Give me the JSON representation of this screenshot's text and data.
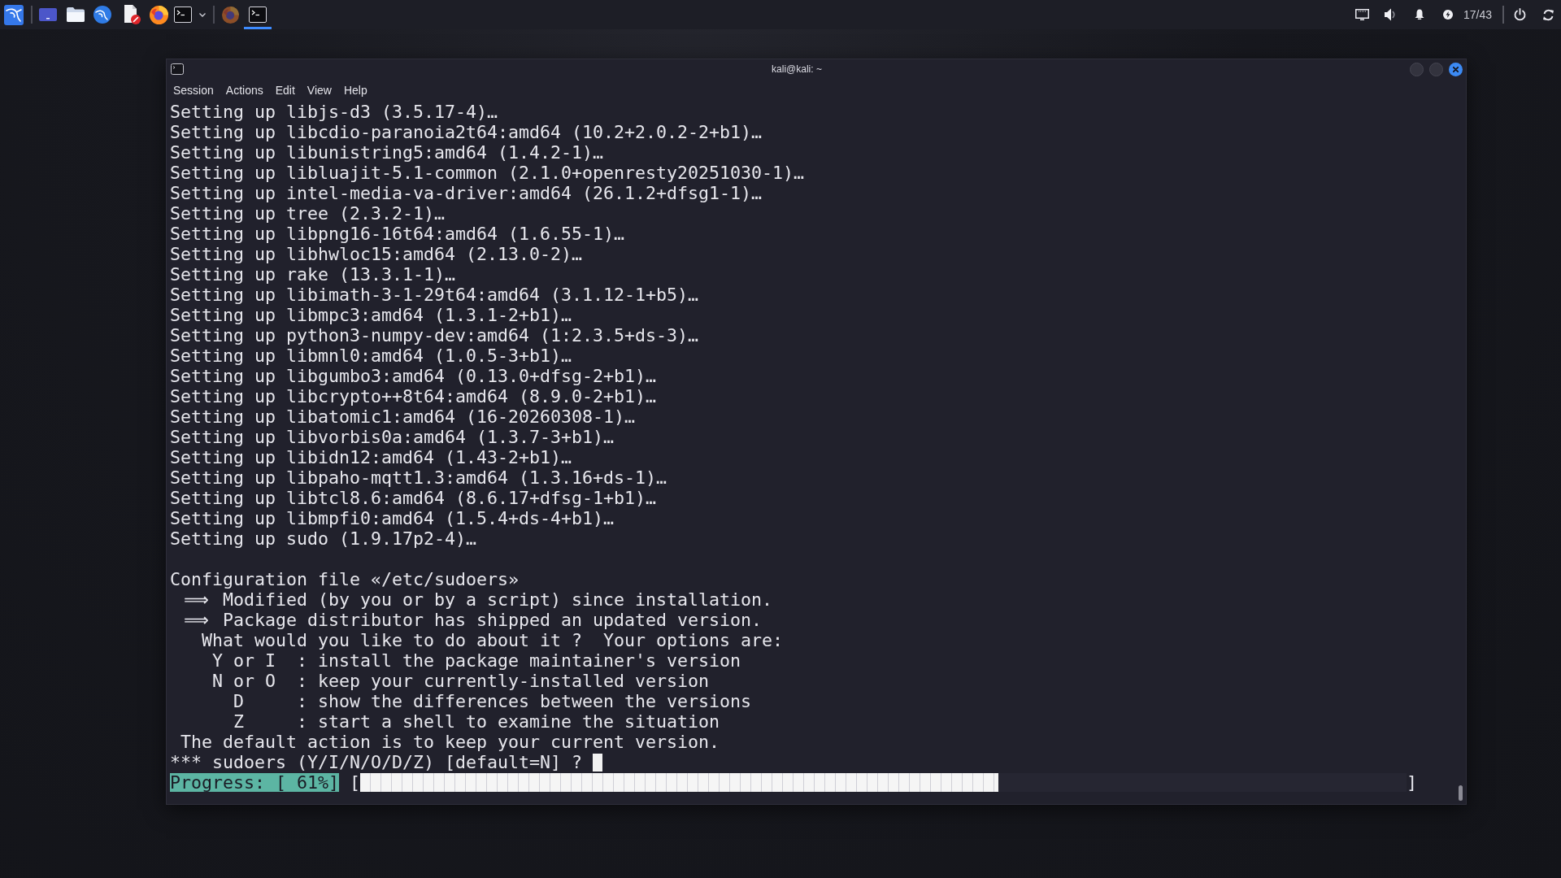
{
  "taskbar": {
    "tasks": [
      {
        "kind": "browser",
        "selected": false
      },
      {
        "kind": "terminal",
        "selected": true
      }
    ],
    "tray_text": "17/43"
  },
  "window": {
    "title": "kali@kali: ~",
    "menu": [
      "Session",
      "Actions",
      "Edit",
      "View",
      "Help"
    ],
    "lines": [
      {
        "kind": "text",
        "text": "Setting up libjs-d3 (3.5.17-4)…"
      },
      {
        "kind": "text",
        "text": "Setting up libcdio-paranoia2t64:amd64 (10.2+2.0.2-2+b1)…"
      },
      {
        "kind": "text",
        "text": "Setting up libunistring5:amd64 (1.4.2-1)…"
      },
      {
        "kind": "text",
        "text": "Setting up libluajit-5.1-common (2.1.0+openresty20251030-1)…"
      },
      {
        "kind": "text",
        "text": "Setting up intel-media-va-driver:amd64 (26.1.2+dfsg1-1)…"
      },
      {
        "kind": "text",
        "text": "Setting up tree (2.3.2-1)…"
      },
      {
        "kind": "text",
        "text": "Setting up libpng16-16t64:amd64 (1.6.55-1)…"
      },
      {
        "kind": "text",
        "text": "Setting up libhwloc15:amd64 (2.13.0-2)…"
      },
      {
        "kind": "text",
        "text": "Setting up rake (13.3.1-1)…"
      },
      {
        "kind": "text",
        "text": "Setting up libimath-3-1-29t64:amd64 (3.1.12-1+b5)…"
      },
      {
        "kind": "text",
        "text": "Setting up libmpc3:amd64 (1.3.1-2+b1)…"
      },
      {
        "kind": "text",
        "text": "Setting up python3-numpy-dev:amd64 (1:2.3.5+ds-3)…"
      },
      {
        "kind": "text",
        "text": "Setting up libmnl0:amd64 (1.0.5-3+b1)…"
      },
      {
        "kind": "text",
        "text": "Setting up libgumbo3:amd64 (0.13.0+dfsg-2+b1)…"
      },
      {
        "kind": "text",
        "text": "Setting up libcrypto++8t64:amd64 (8.9.0-2+b1)…"
      },
      {
        "kind": "text",
        "text": "Setting up libatomic1:amd64 (16-20260308-1)…"
      },
      {
        "kind": "text",
        "text": "Setting up libvorbis0a:amd64 (1.3.7-3+b1)…"
      },
      {
        "kind": "text",
        "text": "Setting up libidn12:amd64 (1.43-2+b1)…"
      },
      {
        "kind": "text",
        "text": "Setting up libpaho-mqtt1.3:amd64 (1.3.16+ds-1)…"
      },
      {
        "kind": "text",
        "text": "Setting up libtcl8.6:amd64 (8.6.17+dfsg-1+b1)…"
      },
      {
        "kind": "text",
        "text": "Setting up libmpfi0:amd64 (1.5.4+ds-4+b1)…"
      },
      {
        "kind": "text",
        "text": "Setting up sudo (1.9.17p2-4)…"
      },
      {
        "kind": "blank"
      },
      {
        "kind": "text",
        "text": "Configuration file «/etc/sudoers»"
      },
      {
        "kind": "arrow",
        "marker": "⟹",
        "text": "Modified (by you or by a script) since installation."
      },
      {
        "kind": "arrow",
        "marker": "⟹",
        "text": "Package distributor has shipped an updated version."
      },
      {
        "kind": "text",
        "text": "   What would you like to do about it ?  Your options are:"
      },
      {
        "kind": "text",
        "text": "    Y or I  : install the package maintainer's version"
      },
      {
        "kind": "text",
        "text": "    N or O  : keep your currently-installed version"
      },
      {
        "kind": "text",
        "text": "      D     : show the differences between the versions"
      },
      {
        "kind": "text",
        "text": "      Z     : start a shell to examine the situation"
      },
      {
        "kind": "text",
        "text": " The default action is to keep your current version."
      },
      {
        "kind": "prompt",
        "text": "*** sudoers (Y/I/N/O/D/Z) [default=N] ?"
      }
    ],
    "progress": {
      "label": "Progress: [ 61%]",
      "open": "[",
      "close": "]",
      "level": 0.61
    }
  }
}
